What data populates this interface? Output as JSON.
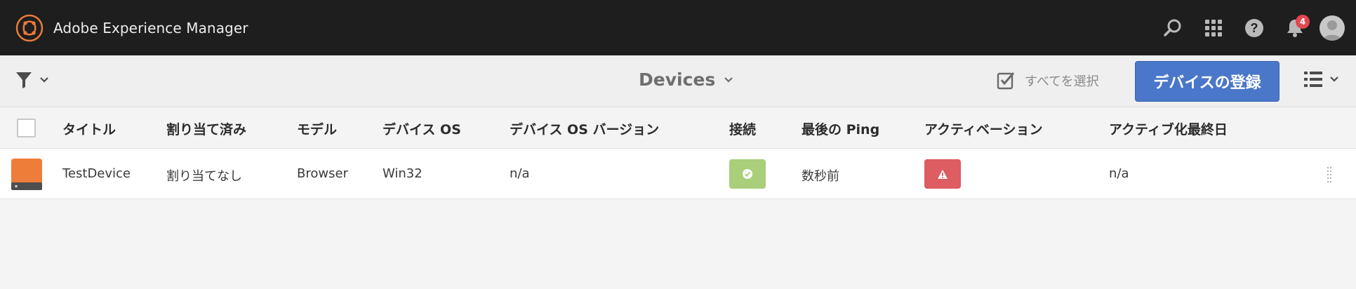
{
  "shell": {
    "app_name": "Adobe Experience Manager",
    "notification_count": "4",
    "icons": [
      "adobe-experience-logo",
      "search-icon",
      "apps-grid-icon",
      "help-icon",
      "bell-icon",
      "user-avatar"
    ]
  },
  "actionbar": {
    "title": "Devices",
    "select_all_label": "すべてを選択",
    "register_button_label": "デバイスの登録",
    "icons": [
      "filter-icon",
      "chevron-down-icon",
      "select-all-icon",
      "list-view-icon"
    ]
  },
  "table": {
    "columns": [
      "タイトル",
      "割り当て済み",
      "モデル",
      "デバイス OS",
      "デバイス OS バージョン",
      "接続",
      "最後の Ping",
      "アクティベーション",
      "アクティブ化最終日"
    ],
    "rows": [
      {
        "title": "TestDevice",
        "assigned": "割り当てなし",
        "model": "Browser",
        "os": "Win32",
        "os_version": "n/a",
        "connection": "ok",
        "last_ping": "数秒前",
        "activation": "warning",
        "activation_last_date": "n/a"
      }
    ]
  },
  "colors": {
    "shell_bg": "#1e1e1e",
    "accent_orange": "#ee7a3a",
    "primary_button": "#4a77c9",
    "status_ok": "#a9cf7a",
    "status_warning": "#dd5d63",
    "badge": "#e34850"
  }
}
